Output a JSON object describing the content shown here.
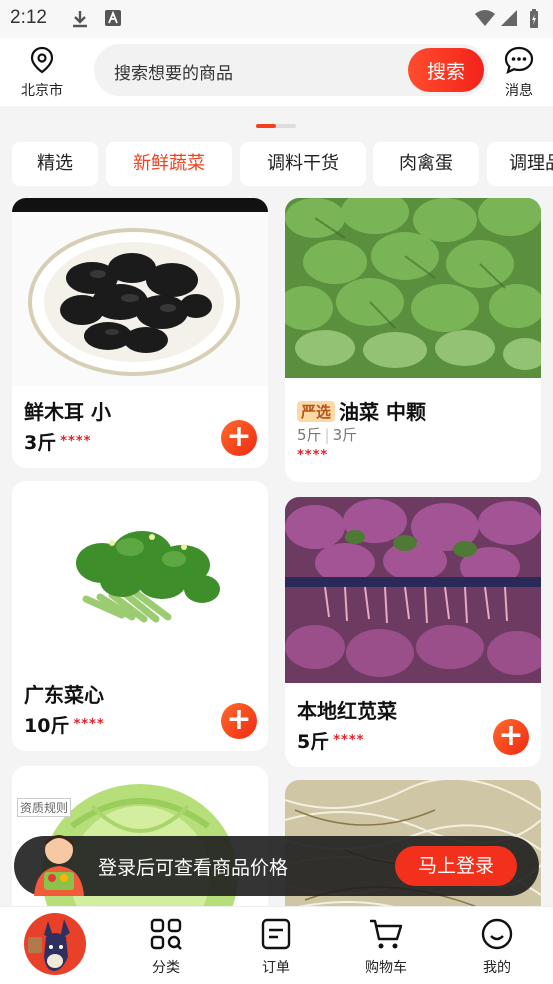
{
  "status_bar": {
    "time": "2:12"
  },
  "header": {
    "location_label": "北京市",
    "search_placeholder": "搜索想要的商品",
    "search_button": "搜索",
    "message_label": "消息"
  },
  "category_tabs": [
    {
      "label": "精选"
    },
    {
      "label": "新鲜蔬菜",
      "active": true
    },
    {
      "label": "调料干货"
    },
    {
      "label": "肉禽蛋"
    },
    {
      "label": "调理品"
    }
  ],
  "products": [
    {
      "name": "鲜木耳 小",
      "price": "3斤",
      "stars": "****"
    },
    {
      "badge": "严选",
      "name": "油菜 中颗",
      "spec_a": "5斤",
      "spec_b": "3斤",
      "stars": "****"
    },
    {
      "name": "广东菜心",
      "price": "10斤",
      "stars": "****"
    },
    {
      "name": "本地红苋菜",
      "price": "5斤",
      "stars": "****"
    },
    {
      "tag": "资质规则"
    },
    {}
  ],
  "login_banner": {
    "text": "登录后可查看商品价格",
    "button": "马上登录"
  },
  "bottom_nav": [
    {
      "label": "分类"
    },
    {
      "label": "订单"
    },
    {
      "label": "购物车"
    },
    {
      "label": "我的"
    }
  ],
  "colors": {
    "accent": "#f3401e",
    "star": "#e6212a"
  }
}
